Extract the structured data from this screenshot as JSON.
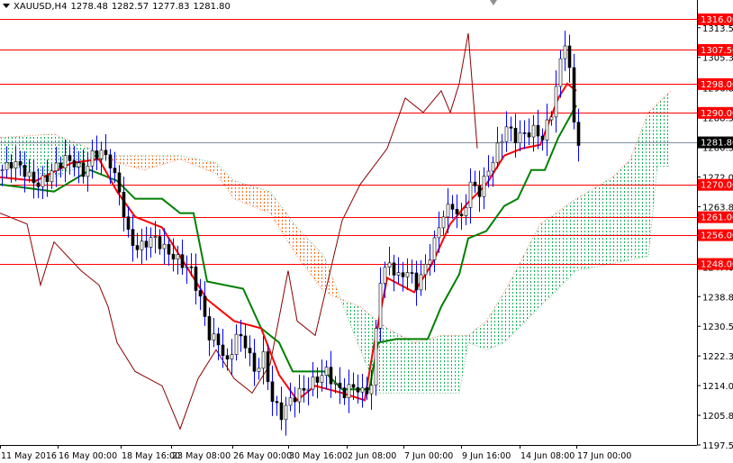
{
  "header": {
    "symbol": "XAUUSD,H4",
    "open": "1278.48",
    "high": "1282.57",
    "low": "1277.83",
    "close": "1281.80"
  },
  "colors": {
    "level": "#ff0000",
    "tenkan": "#ff0000",
    "kijun": "#008000",
    "chikou": "#8b0000",
    "cloud_bull": "#00b050",
    "cloud_bear": "#ff6600",
    "wick": "#0000ff",
    "current": "#8090a0"
  },
  "chart_data": {
    "type": "candlestick",
    "title": "XAUUSD,H4",
    "ylim": [
      1197.55,
      1316.0
    ],
    "xlim": [
      0,
      155
    ],
    "y_ticks": [
      "1313.55",
      "1305.30",
      "1296.80",
      "1288.55",
      "1280.30",
      "1272.05",
      "1263.80",
      "1255.30",
      "1247.05",
      "1238.80",
      "1230.55",
      "1222.30",
      "1214.05",
      "1205.80",
      "1197.55"
    ],
    "x_ticks": [
      {
        "bar": 0,
        "label": "11 May 2016"
      },
      {
        "bar": 12.8,
        "label": "16 May 00:00"
      },
      {
        "bar": 26.8,
        "label": "18 May 16:00"
      },
      {
        "bar": 38,
        "label": "23 May 08:00"
      },
      {
        "bar": 51.6,
        "label": "26 May 00:00"
      },
      {
        "bar": 64,
        "label": "30 May 16:00"
      },
      {
        "bar": 77,
        "label": "2 Jun 08:00"
      },
      {
        "bar": 89.6,
        "label": "7 Jun 00:00"
      },
      {
        "bar": 102.4,
        "label": "9 Jun 16:00"
      },
      {
        "bar": 115.4,
        "label": "14 Jun 08:00"
      },
      {
        "bar": 128,
        "label": "17 Jun 00:00"
      }
    ],
    "levels": [
      {
        "price": 1316.0,
        "label": "1316.00"
      },
      {
        "price": 1307.5,
        "label": "1307.50"
      },
      {
        "price": 1298.0,
        "label": "1298.00"
      },
      {
        "price": 1290.0,
        "label": "1290.00"
      },
      {
        "price": 1270.0,
        "label": "1270.00"
      },
      {
        "price": 1261.0,
        "label": "1261.00"
      },
      {
        "price": 1256.0,
        "label": "1256.00"
      },
      {
        "price": 1248.0,
        "label": "1248.00"
      }
    ],
    "current_price": {
      "price": 1281.8,
      "label": "1281.80"
    },
    "close": [
      [
        0,
        1274
      ],
      [
        2,
        1276
      ],
      [
        4,
        1275
      ],
      [
        6,
        1272
      ],
      [
        8,
        1270
      ],
      [
        10,
        1272
      ],
      [
        12,
        1275
      ],
      [
        14,
        1277
      ],
      [
        16,
        1276
      ],
      [
        18,
        1273
      ],
      [
        20,
        1278
      ],
      [
        22,
        1279
      ],
      [
        24,
        1276
      ],
      [
        26,
        1268
      ],
      [
        28,
        1256
      ],
      [
        30,
        1252
      ],
      [
        32,
        1254
      ],
      [
        34,
        1255
      ],
      [
        36,
        1252
      ],
      [
        38,
        1250
      ],
      [
        40,
        1248
      ],
      [
        42,
        1246
      ],
      [
        44,
        1238
      ],
      [
        46,
        1228
      ],
      [
        48,
        1226
      ],
      [
        50,
        1220
      ],
      [
        52,
        1228
      ],
      [
        54,
        1226
      ],
      [
        56,
        1218
      ],
      [
        58,
        1222
      ],
      [
        60,
        1210
      ],
      [
        62,
        1206
      ],
      [
        64,
        1210
      ],
      [
        66,
        1212
      ],
      [
        68,
        1214
      ],
      [
        70,
        1216
      ],
      [
        72,
        1218
      ],
      [
        74,
        1214
      ],
      [
        76,
        1212
      ],
      [
        78,
        1214
      ],
      [
        80,
        1212
      ],
      [
        82,
        1214
      ],
      [
        84,
        1244
      ],
      [
        86,
        1248
      ],
      [
        88,
        1244
      ],
      [
        90,
        1246
      ],
      [
        92,
        1242
      ],
      [
        94,
        1247
      ],
      [
        96,
        1254
      ],
      [
        98,
        1262
      ],
      [
        100,
        1264
      ],
      [
        102,
        1260
      ],
      [
        104,
        1270
      ],
      [
        106,
        1268
      ],
      [
        108,
        1274
      ],
      [
        110,
        1280
      ],
      [
        112,
        1286
      ],
      [
        114,
        1283
      ],
      [
        116,
        1284
      ],
      [
        118,
        1285
      ],
      [
        120,
        1283
      ],
      [
        122,
        1290
      ],
      [
        124,
        1304
      ],
      [
        125,
        1310
      ],
      [
        126.4,
        1298
      ],
      [
        127.4,
        1280
      ],
      [
        128,
        1282
      ]
    ],
    "series": [
      {
        "name": "Tenkan-sen",
        "points": [
          [
            0,
            1272
          ],
          [
            8,
            1271
          ],
          [
            16,
            1276
          ],
          [
            22,
            1277
          ],
          [
            26,
            1268
          ],
          [
            30,
            1261
          ],
          [
            36,
            1258
          ],
          [
            40,
            1250
          ],
          [
            46,
            1238
          ],
          [
            52,
            1232
          ],
          [
            58,
            1230
          ],
          [
            62,
            1217
          ],
          [
            66,
            1210
          ],
          [
            70,
            1214
          ],
          [
            76,
            1212
          ],
          [
            81,
            1210
          ],
          [
            83,
            1225
          ],
          [
            86,
            1244
          ],
          [
            92,
            1240
          ],
          [
            96,
            1248
          ],
          [
            100,
            1259
          ],
          [
            104,
            1265
          ],
          [
            108,
            1270
          ],
          [
            112,
            1278
          ],
          [
            116,
            1280
          ],
          [
            120,
            1281
          ],
          [
            124,
            1294
          ],
          [
            126,
            1298
          ],
          [
            128,
            1296
          ]
        ]
      },
      {
        "name": "Kijun-sen",
        "points": [
          [
            0,
            1270
          ],
          [
            12,
            1268
          ],
          [
            20,
            1274
          ],
          [
            26,
            1271
          ],
          [
            30,
            1266
          ],
          [
            36,
            1266
          ],
          [
            40,
            1262
          ],
          [
            43,
            1262
          ],
          [
            46,
            1243
          ],
          [
            54,
            1241
          ],
          [
            58,
            1230
          ],
          [
            62,
            1226
          ],
          [
            65,
            1218
          ],
          [
            72,
            1218
          ],
          [
            76,
            1213
          ],
          [
            82,
            1213
          ],
          [
            84,
            1226
          ],
          [
            88,
            1227
          ],
          [
            95,
            1227
          ],
          [
            98,
            1236
          ],
          [
            102,
            1245
          ],
          [
            104,
            1255
          ],
          [
            108,
            1257
          ],
          [
            112,
            1264
          ],
          [
            115,
            1266
          ],
          [
            118,
            1274
          ],
          [
            121,
            1274
          ],
          [
            124,
            1283
          ],
          [
            128,
            1292
          ]
        ]
      },
      {
        "name": "Chikou Span",
        "points": [
          [
            0,
            1262
          ],
          [
            6,
            1259
          ],
          [
            9,
            1242
          ],
          [
            12,
            1254
          ],
          [
            18,
            1246
          ],
          [
            22,
            1242
          ],
          [
            24,
            1236
          ],
          [
            26,
            1226
          ],
          [
            30,
            1218
          ],
          [
            36,
            1214
          ],
          [
            40,
            1202
          ],
          [
            44,
            1216
          ],
          [
            48,
            1224
          ],
          [
            52,
            1216
          ],
          [
            56,
            1212
          ],
          [
            60,
            1220
          ],
          [
            64,
            1246
          ],
          [
            66,
            1232
          ],
          [
            70,
            1228
          ],
          [
            76,
            1260
          ],
          [
            80,
            1270
          ],
          [
            86,
            1280
          ],
          [
            90,
            1294
          ],
          [
            94,
            1290
          ],
          [
            98,
            1296
          ],
          [
            100,
            1290
          ],
          [
            102,
            1298
          ],
          [
            104,
            1312
          ],
          [
            106,
            1280
          ]
        ]
      },
      {
        "name": "Senkou Span A",
        "points": [
          [
            0,
            1283
          ],
          [
            12,
            1284
          ],
          [
            20,
            1280
          ],
          [
            26,
            1276
          ],
          [
            32,
            1274
          ],
          [
            40,
            1277
          ],
          [
            48,
            1273
          ],
          [
            52,
            1266
          ],
          [
            60,
            1262
          ],
          [
            66,
            1250
          ],
          [
            72,
            1240
          ],
          [
            80,
            1236
          ],
          [
            86,
            1230
          ],
          [
            92,
            1226
          ],
          [
            98,
            1228
          ],
          [
            104,
            1228
          ],
          [
            108,
            1232
          ],
          [
            112,
            1240
          ],
          [
            120,
            1259
          ],
          [
            128,
            1266
          ],
          [
            136,
            1272
          ],
          [
            140,
            1277
          ],
          [
            144,
            1290
          ],
          [
            149,
            1296
          ]
        ]
      },
      {
        "name": "Senkou Span B",
        "points": [
          [
            0,
            1276
          ],
          [
            12,
            1272
          ],
          [
            20,
            1276
          ],
          [
            26,
            1278
          ],
          [
            32,
            1278
          ],
          [
            40,
            1278
          ],
          [
            48,
            1276
          ],
          [
            52,
            1271
          ],
          [
            60,
            1268
          ],
          [
            66,
            1258
          ],
          [
            72,
            1250
          ],
          [
            80,
            1224
          ],
          [
            84,
            1212
          ],
          [
            102,
            1212
          ],
          [
            104,
            1226
          ],
          [
            108,
            1224
          ],
          [
            112,
            1226
          ],
          [
            120,
            1236
          ],
          [
            128,
            1246
          ],
          [
            136,
            1248
          ],
          [
            144,
            1250
          ],
          [
            146,
            1275
          ],
          [
            149,
            1275
          ]
        ]
      }
    ]
  }
}
